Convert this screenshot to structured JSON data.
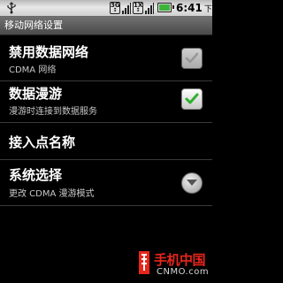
{
  "status_bar": {
    "network_badge_top": "3G",
    "network_badge_bottom": "↕",
    "roaming_badge": "1X",
    "time": "6:41",
    "ampm": "下午",
    "battery_color": "#3cb43c"
  },
  "title_bar": {
    "title": "移动网络设置"
  },
  "preferences": [
    {
      "title": "禁用数据网络",
      "summary": "CDMA 网络",
      "control": "checkbox",
      "checked": false,
      "enabled": false
    },
    {
      "title": "数据漫游",
      "summary": "漫游时连接到数据服务",
      "control": "checkbox",
      "checked": true,
      "enabled": true
    },
    {
      "title": "接入点名称",
      "summary": "",
      "control": "none"
    },
    {
      "title": "系统选择",
      "summary": "更改 CDMA 漫游模式",
      "control": "dropdown"
    }
  ],
  "watermark": {
    "brand": "手机中国",
    "site": "CNMO.com"
  },
  "colors": {
    "check_green": "#2fb12f",
    "watermark_red": "#e8261c"
  }
}
